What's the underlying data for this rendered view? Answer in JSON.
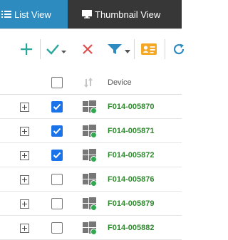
{
  "tabs": [
    {
      "label": "List View",
      "active": true,
      "icon": "list-icon"
    },
    {
      "label": "Thumbnail View",
      "active": false,
      "icon": "monitor-icon"
    }
  ],
  "toolbar": [
    {
      "name": "add-button",
      "icon": "plus-icon",
      "color": "#2aa69a"
    },
    {
      "name": "approve-button",
      "icon": "check-dropdown-icon",
      "color": "#2aa69a"
    },
    {
      "name": "remove-button",
      "icon": "close-icon",
      "color": "#e04b4b"
    },
    {
      "name": "filter-button",
      "icon": "filter-dropdown-icon",
      "color": "#2e8bbf"
    },
    {
      "name": "contact-card-button",
      "icon": "id-card-icon",
      "color": "#f5a623"
    },
    {
      "name": "refresh-button",
      "icon": "refresh-icon",
      "color": "#2e8bbf"
    }
  ],
  "table": {
    "header": {
      "device": "Device",
      "select_all_checked": false
    },
    "rows": [
      {
        "device": "F014-005870",
        "checked": true,
        "status": "online"
      },
      {
        "device": "F014-005871",
        "checked": true,
        "status": "online"
      },
      {
        "device": "F014-005872",
        "checked": true,
        "status": "online"
      },
      {
        "device": "F014-005876",
        "checked": false,
        "status": "online"
      },
      {
        "device": "F014-005879",
        "checked": false,
        "status": "online"
      },
      {
        "device": "F014-005882",
        "checked": false,
        "status": "online"
      }
    ]
  },
  "colors": {
    "accent": "#2e8bbf",
    "device_text": "#2f8a2f",
    "online": "#2fa84f",
    "checkbox_checked": "#1a73e8"
  }
}
